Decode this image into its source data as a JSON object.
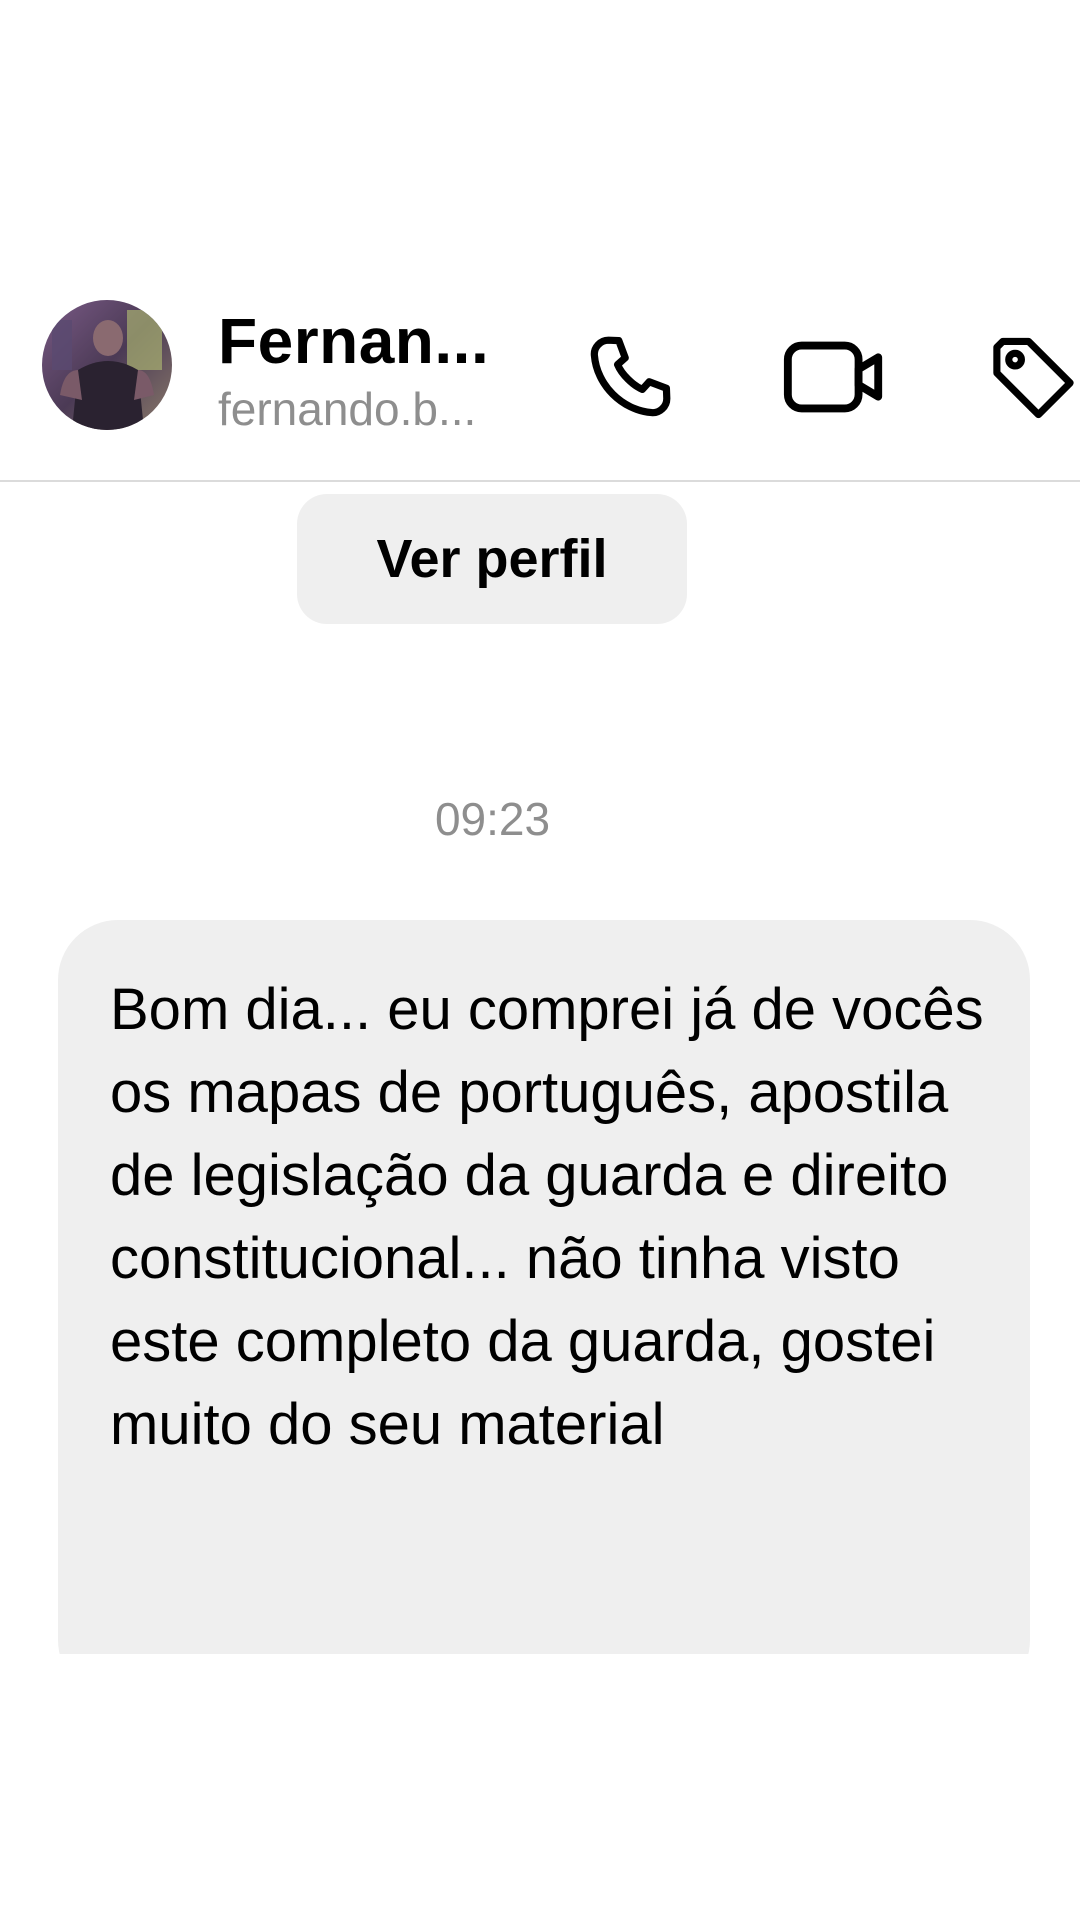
{
  "header": {
    "name": "Fernan...",
    "username": "fernando.b...",
    "avatar_icon": "avatar-photo",
    "call_icon": "phone-icon",
    "video_icon": "video-camera-icon",
    "tag_icon": "tag-icon"
  },
  "profile_button": {
    "label": "Ver perfil"
  },
  "conversation": {
    "timestamp": "09:23",
    "messages": [
      {
        "direction": "incoming",
        "text": "Bom dia... eu comprei já de vocês os mapas de português, apostila de legislação da guarda e direito constitucional... não tinha visto este completo da guarda, gostei muito do seu material"
      }
    ]
  },
  "colors": {
    "bubble": "#efefef",
    "secondary_text": "#8e8e8e",
    "divider": "#dbdbdb"
  }
}
